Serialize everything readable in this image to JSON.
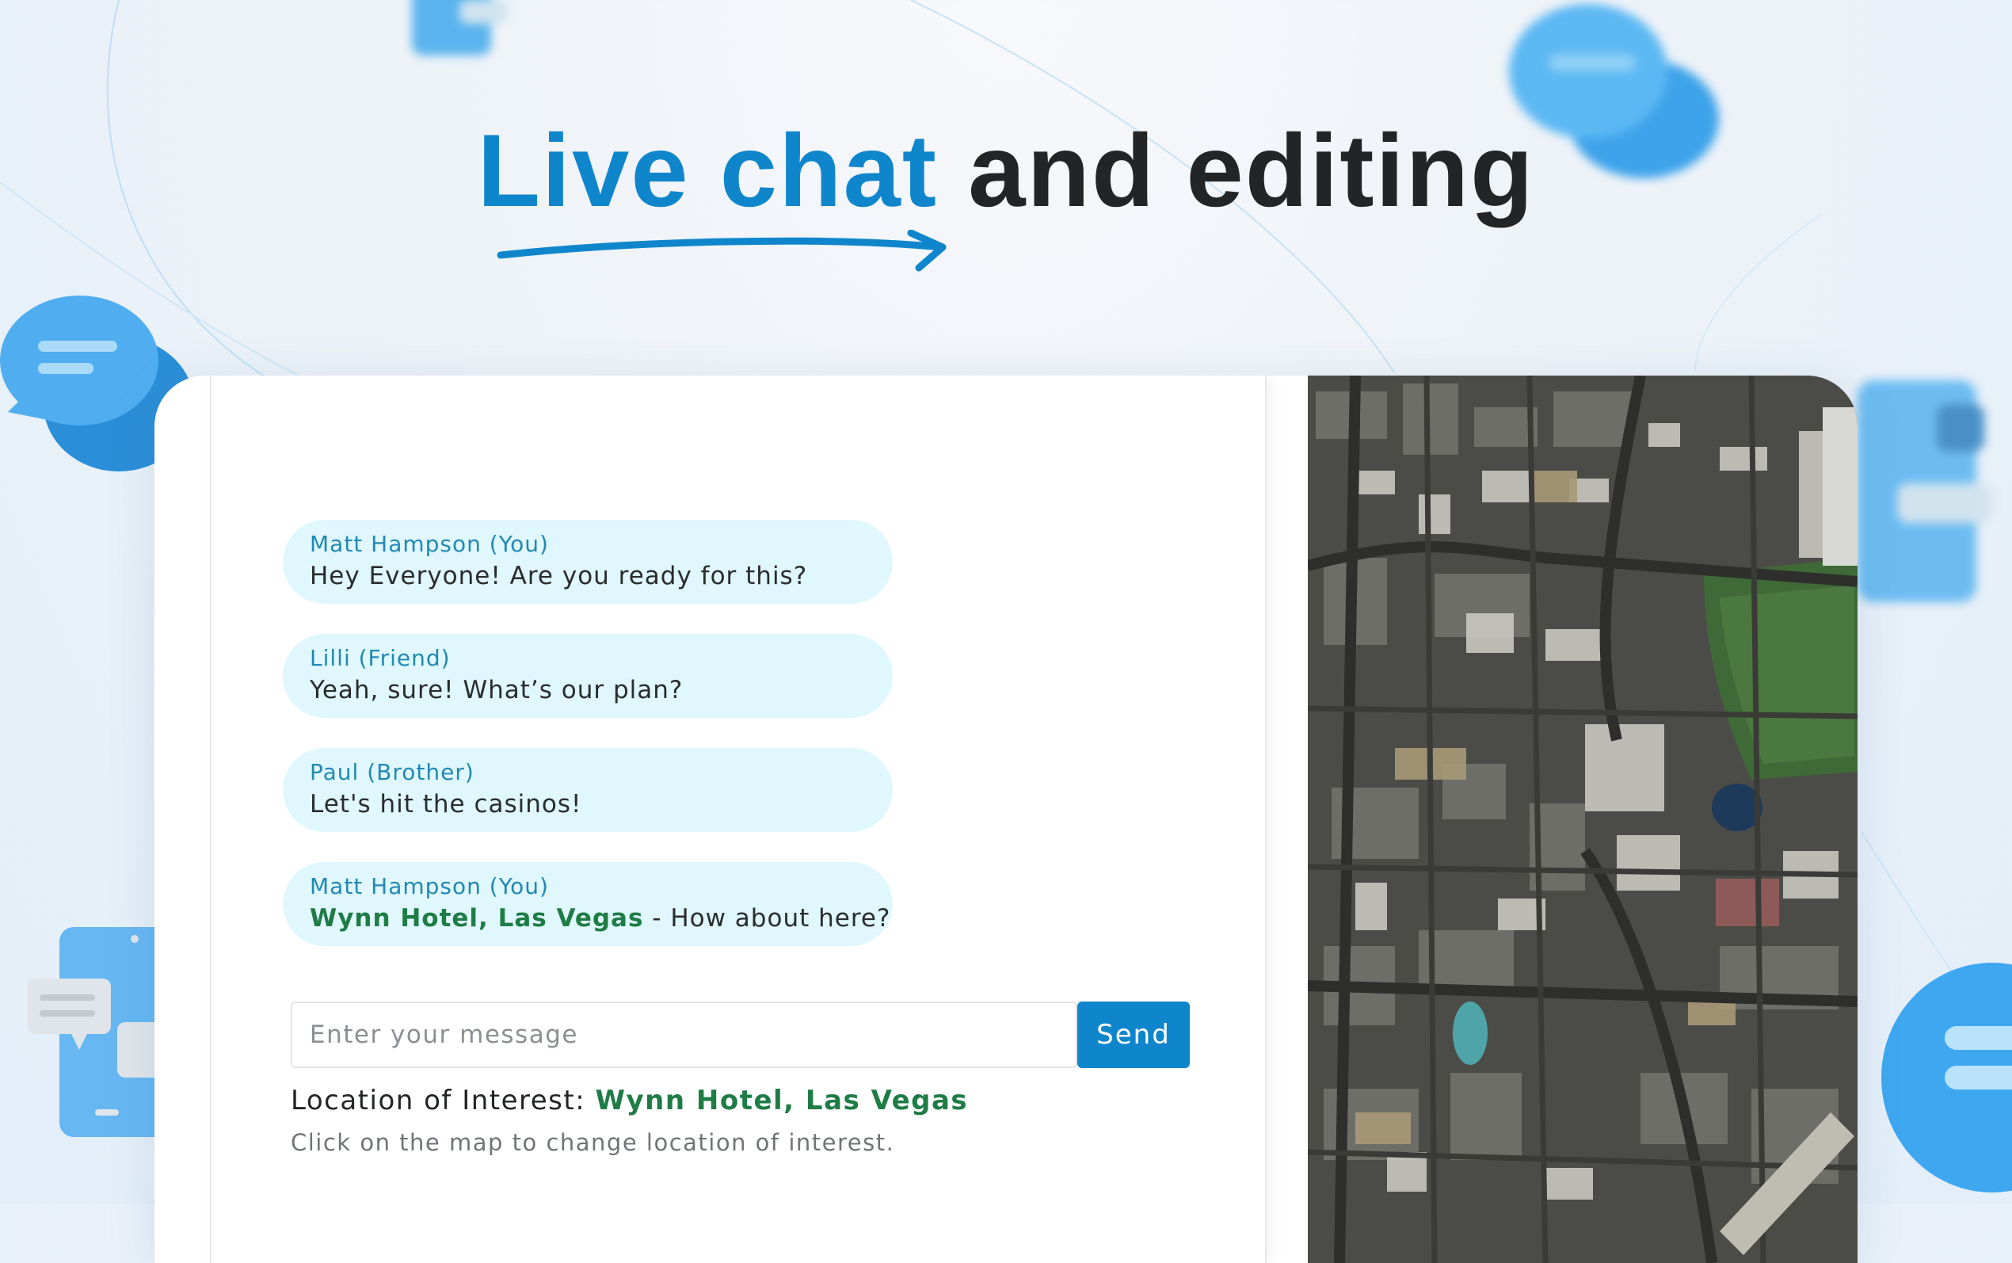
{
  "headline": {
    "accent": "Live chat",
    "rest": "and editing"
  },
  "chat": {
    "messages": [
      {
        "sender": "Matt Hampson (You)",
        "text": "Hey Everyone! Are you ready for this?"
      },
      {
        "sender": "Lilli (Friend)",
        "text": "Yeah, sure! What’s our plan?"
      },
      {
        "sender": "Paul (Brother)",
        "text": "Let's hit the casinos!"
      },
      {
        "sender": "Matt Hampson (You)",
        "location": "Wynn Hotel, Las Vegas",
        "text": " - How about here?"
      }
    ],
    "input_placeholder": "Enter your message",
    "send_label": "Send",
    "location_label": "Location of Interest:",
    "location_value": "Wynn Hotel, Las Vegas",
    "hint": "Click on the map to change location of interest."
  },
  "colors": {
    "accent": "#0f86cc",
    "bubble": "#dff7fd",
    "sender": "#2189b3",
    "location": "#1e7c45",
    "text": "#222426"
  },
  "icons": [
    "chat-bubble-icon",
    "tablet-chat-icon"
  ]
}
